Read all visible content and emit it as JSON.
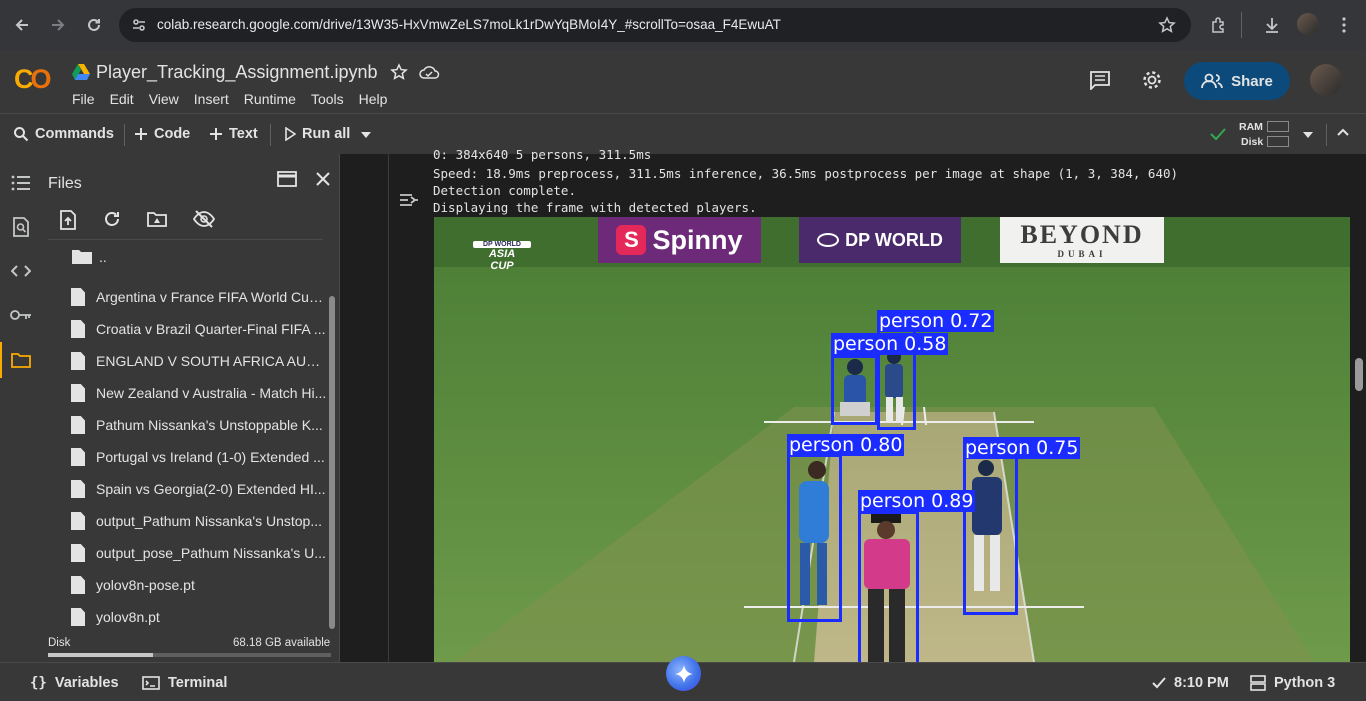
{
  "browser": {
    "url": "colab.research.google.com/drive/13W35-HxVmwZeLS7moLk1rDwYqBMoI4Y_#scrollTo=osaa_F4EwuAT"
  },
  "notebook": {
    "title": "Player_Tracking_Assignment.ipynb",
    "menu": [
      "File",
      "Edit",
      "View",
      "Insert",
      "Runtime",
      "Tools",
      "Help"
    ],
    "share_label": "Share"
  },
  "toolbar": {
    "commands": "Commands",
    "code": "Code",
    "text": "Text",
    "run_all": "Run all",
    "ram": "RAM",
    "disk": "Disk"
  },
  "files_panel": {
    "title": "Files",
    "parent_dir": "..",
    "items": [
      "Argentina v France FIFA World Cup...",
      "Croatia v Brazil Quarter-Final FIFA ...",
      "ENGLAND V SOUTH AFRICA AUTU...",
      "New Zealand v Australia - Match Hi...",
      "Pathum Nissanka's Unstoppable K...",
      "Portugal vs Ireland (1-0) Extended ...",
      "Spain vs Georgia(2-0) Extended HI...",
      "output_Pathum Nissanka's Unstop...",
      "output_pose_Pathum Nissanka's U...",
      "yolov8n-pose.pt",
      "yolov8n.pt"
    ],
    "disk_label": "Disk",
    "disk_available": "68.18 GB available",
    "disk_used_fraction": 0.37
  },
  "output": {
    "lines": [
      "0: 384x640 5 persons, 311.5ms",
      "Speed: 18.9ms preprocess, 311.5ms inference, 36.5ms postprocess per image at shape (1, 3, 384, 640)",
      "Detection complete.",
      "Displaying the frame with detected players."
    ]
  },
  "frame": {
    "ads": [
      "Spinny",
      "DP WORLD",
      "BEYOND",
      "DUBAI"
    ],
    "logo": [
      "DP WORLD",
      "ASIA",
      "CUP"
    ],
    "detections": [
      {
        "label": "person 0.72"
      },
      {
        "label": "person 0.58"
      },
      {
        "label": "person 0.80"
      },
      {
        "label": "person 0.75"
      },
      {
        "label": "person 0.89"
      }
    ]
  },
  "statusbar": {
    "variables": "Variables",
    "terminal": "Terminal",
    "time": "8:10 PM",
    "kernel": "Python 3"
  },
  "colors": {
    "accent_blue": "#0b4a7a",
    "box_blue": "#1a2cff",
    "colab_orange": "#f9ab00"
  }
}
